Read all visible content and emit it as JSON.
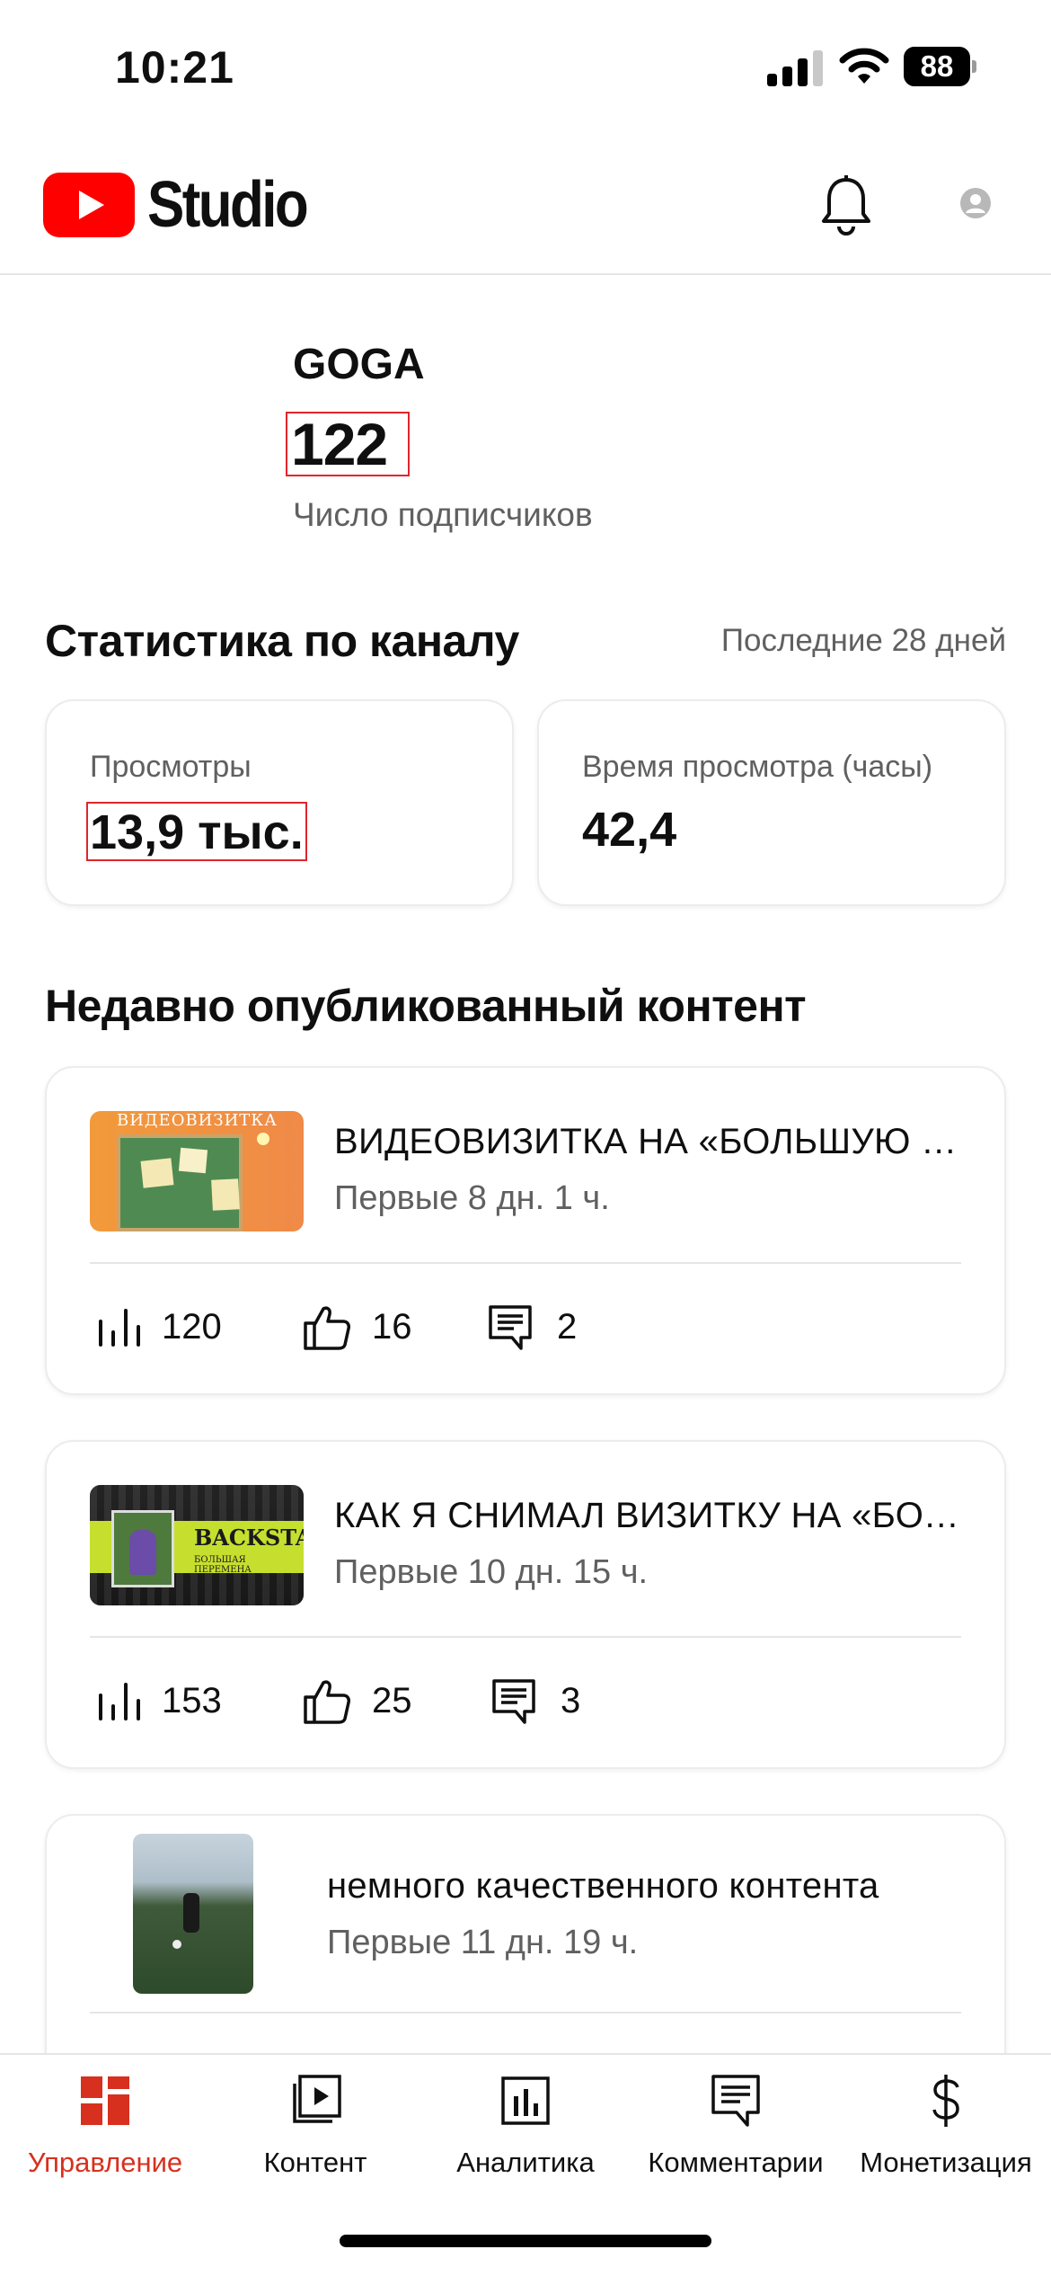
{
  "status_bar": {
    "time": "10:21",
    "battery": "88"
  },
  "header": {
    "logo_text": "Studio",
    "brand_color": "#ff0000"
  },
  "channel": {
    "name": "GOGA",
    "subscribers": "122",
    "subscribers_label": "Число подписчиков"
  },
  "stats": {
    "title": "Статистика по каналу",
    "period": "Последние 28 дней",
    "cards": [
      {
        "label": "Просмотры",
        "value": "13,9 тыс."
      },
      {
        "label": "Время просмотра (часы)",
        "value": "42,4"
      }
    ]
  },
  "recent": {
    "title": "Недавно опубликованный контент",
    "videos": [
      {
        "title": "ВИДЕОВИЗИТКА НА «БОЛЬШУЮ ПЕРЕМЕНУ»",
        "age": "Первые 8 дн. 1 ч.",
        "views": "120",
        "likes": "16",
        "comments": "2",
        "thumb_caption": "ВИДЕОВИЗИТКА"
      },
      {
        "title": "КАК Я СНИМАЛ ВИЗИТКУ НА «БОЛЬШУЮ ПЕРЕМЕНУ»",
        "age": "Первые 10 дн. 15 ч.",
        "views": "153",
        "likes": "25",
        "comments": "3",
        "thumb_caption": "BACKSTAGE",
        "thumb_subcaption": "БОЛЬШАЯ ПЕРЕМЕНА"
      },
      {
        "title": "немного качественного контента",
        "age": "Первые 11 дн. 19 ч."
      }
    ]
  },
  "bottom_nav": {
    "accent_color": "#d8301e",
    "items": [
      {
        "label": "Управление",
        "icon": "dashboard-icon",
        "active": true
      },
      {
        "label": "Контент",
        "icon": "content-icon"
      },
      {
        "label": "Аналитика",
        "icon": "analytics-icon"
      },
      {
        "label": "Комментарии",
        "icon": "comments-icon"
      },
      {
        "label": "Монетизация",
        "icon": "monetization-icon"
      }
    ]
  }
}
